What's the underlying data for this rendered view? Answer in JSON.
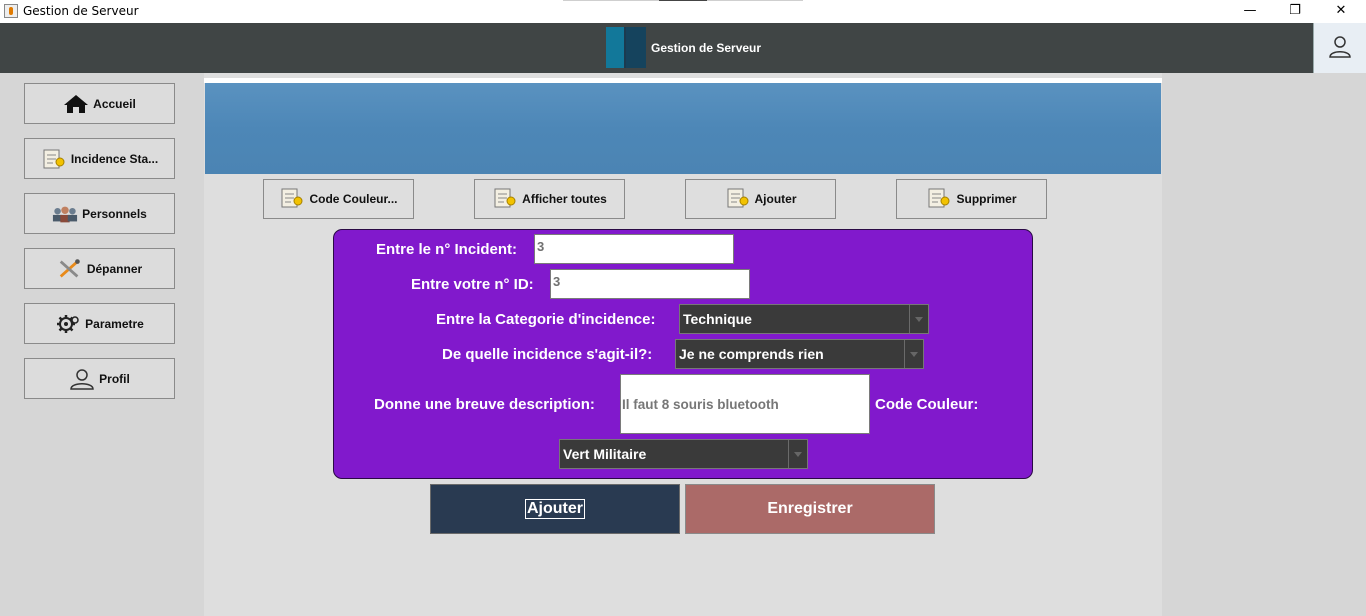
{
  "window": {
    "title": "Gestion de Serveur",
    "controls": {
      "minimize": "—",
      "maximize": "❐",
      "close": "✕"
    }
  },
  "header": {
    "title": "Gestion de Serveur",
    "logo_colors": [
      "#12789a",
      "#15435d"
    ],
    "user_icon": "user-icon"
  },
  "sidebar": {
    "items": [
      {
        "label": "Accueil",
        "icon": "home-icon"
      },
      {
        "label": "Incidence Sta...",
        "icon": "scroll-icon"
      },
      {
        "label": "Personnels",
        "icon": "people-icon"
      },
      {
        "label": "Dépanner",
        "icon": "tools-icon"
      },
      {
        "label": "Parametre",
        "icon": "gear-icon"
      },
      {
        "label": "Profil",
        "icon": "user-icon"
      }
    ]
  },
  "toolbar": {
    "buttons": [
      {
        "label": "Code Couleur...",
        "icon": "scroll-icon"
      },
      {
        "label": "Afficher toutes",
        "icon": "scroll-icon"
      },
      {
        "label": "Ajouter",
        "icon": "scroll-icon"
      },
      {
        "label": "Supprimer",
        "icon": "scroll-icon"
      }
    ]
  },
  "form": {
    "incident_label": "Entre le n° Incident:",
    "incident_value": "3",
    "id_label": "Entre votre n° ID:",
    "id_value": "3",
    "category_label": "Entre la Categorie d'incidence:",
    "category_value": "Technique",
    "which_label": "De quelle incidence s'agit-il?:",
    "which_value": "Je ne comprends rien",
    "description_label": "Donne une breuve description:",
    "description_value": "Il faut 8 souris bluetooth",
    "color_label": "Code Couleur:",
    "color_value": "Vert Militaire",
    "background_color": "#8119cc"
  },
  "actions": {
    "add_label": "Ajouter",
    "save_label": "Enregistrer",
    "add_color": "#293a51",
    "save_color": "#ab6a68"
  }
}
